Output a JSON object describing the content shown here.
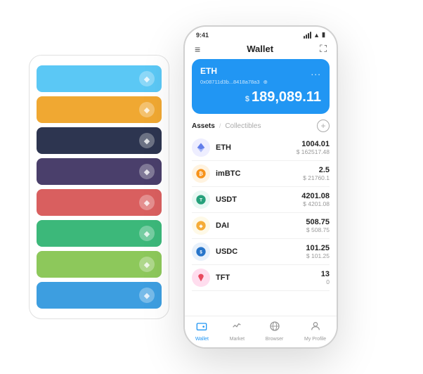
{
  "scene": {
    "card_stack": {
      "cards": [
        {
          "color": "#5bc8f5",
          "icon": "◆"
        },
        {
          "color": "#f0a832",
          "icon": "◆"
        },
        {
          "color": "#2d3550",
          "icon": "◆"
        },
        {
          "color": "#4a3f6b",
          "icon": "◆"
        },
        {
          "color": "#d95f5f",
          "icon": "◆"
        },
        {
          "color": "#3cb87a",
          "icon": "◆"
        },
        {
          "color": "#8dc e5b",
          "icon": "◆"
        },
        {
          "color": "#3d9ee0",
          "icon": "◆"
        }
      ]
    },
    "phone": {
      "status_bar": {
        "time": "9:41",
        "signal": "●●●●",
        "wifi": "▲",
        "battery": "■"
      },
      "header": {
        "menu_icon": "≡",
        "title": "Wallet",
        "expand_icon": "⛶"
      },
      "eth_card": {
        "title": "ETH",
        "address": "0x08711d3b...8418a78a3",
        "address_icon": "⊕",
        "dots": "...",
        "currency_symbol": "$",
        "amount": "189,089.11"
      },
      "assets_section": {
        "tab_active": "Assets",
        "separator": "/",
        "tab_inactive": "Collectibles",
        "add_icon": "+"
      },
      "assets": [
        {
          "name": "ETH",
          "icon_char": "◆",
          "icon_color": "#6c7ae0",
          "amount": "1004.01",
          "usd": "$ 162517.48"
        },
        {
          "name": "imBTC",
          "icon_char": "⊕",
          "icon_color": "#f7931a",
          "amount": "2.5",
          "usd": "$ 21760.1"
        },
        {
          "name": "USDT",
          "icon_char": "T",
          "icon_color": "#26a17b",
          "amount": "4201.08",
          "usd": "$ 4201.08"
        },
        {
          "name": "DAI",
          "icon_char": "◎",
          "icon_color": "#f5ac37",
          "amount": "508.75",
          "usd": "$ 508.75"
        },
        {
          "name": "USDC",
          "icon_char": "$",
          "icon_color": "#2775ca",
          "amount": "101.25",
          "usd": "$ 101.25"
        },
        {
          "name": "TFT",
          "icon_char": "🐦",
          "icon_color": "#e84a5f",
          "amount": "13",
          "usd": "0"
        }
      ],
      "nav": [
        {
          "label": "Wallet",
          "icon": "◎",
          "active": true
        },
        {
          "label": "Market",
          "icon": "📈",
          "active": false
        },
        {
          "label": "Browser",
          "icon": "🌐",
          "active": false
        },
        {
          "label": "My Profile",
          "icon": "👤",
          "active": false
        }
      ]
    }
  }
}
